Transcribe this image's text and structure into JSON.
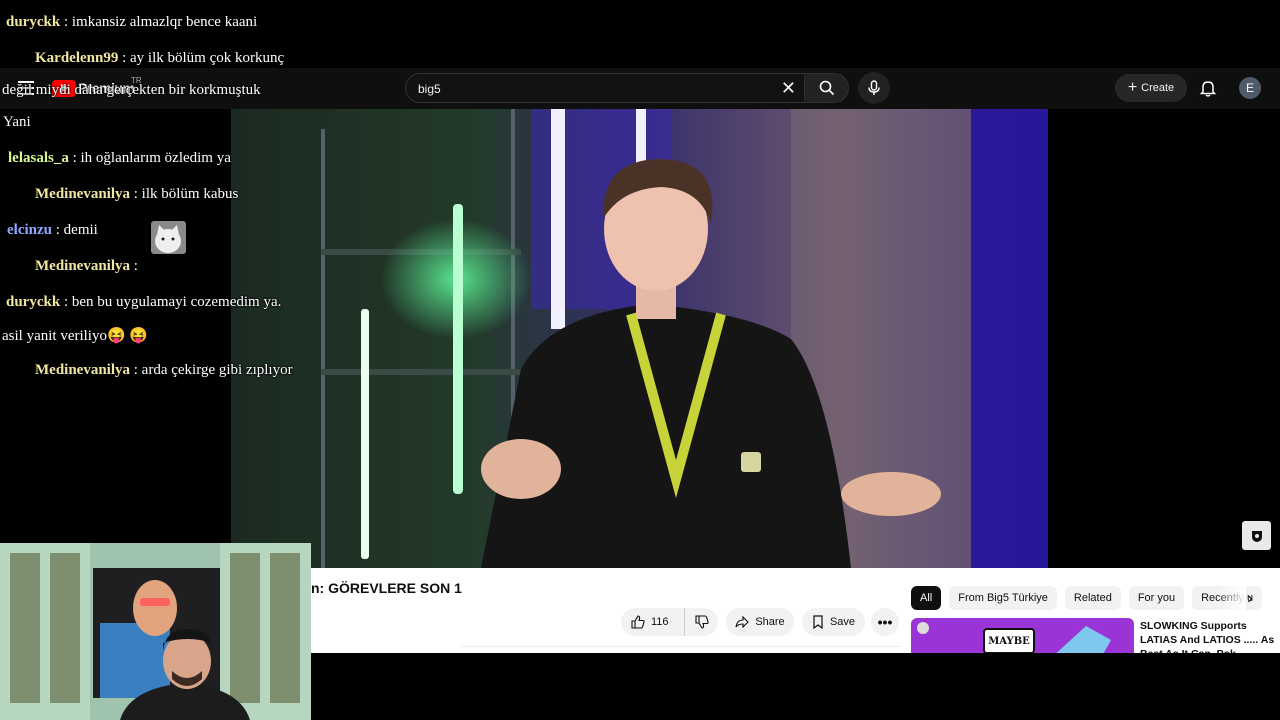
{
  "youtube": {
    "logo_text": "Premium",
    "logo_region": "TR",
    "search": {
      "value": "big5"
    },
    "create_label": "Create",
    "avatar_letter": "E",
    "video_title": "n: GÖREVLERE SON 1",
    "actions": {
      "like_count": "116",
      "share_label": "Share",
      "save_label": "Save"
    },
    "chips": [
      "All",
      "From Big5 Türkiye",
      "Related",
      "For you",
      "Recently u"
    ],
    "recommended": {
      "title": "SLOWKING Supports LATIAS And LATIOS ..... As Best As It Can, Pok…",
      "thumb_text": "MAYBE"
    }
  },
  "chat": [
    {
      "user": "duryckk",
      "text": ": imkansiz almazlqr bence kaani"
    },
    {
      "user": "Kardelenn99",
      "text": ": ay ilk bölüm çok korkunç"
    },
    {
      "user": "",
      "text": "değil miydi daha gerçekten bir korkmuştuk"
    },
    {
      "user": "",
      "text": "Yani"
    },
    {
      "user": "lelasals_a",
      "text": ": ih oğlanlarım özledim ya"
    },
    {
      "user": "Medinevanilya",
      "text": ": ilk bölüm kabus"
    },
    {
      "user": "elcinzu",
      "text": ": demii"
    },
    {
      "user": "Medinevanilya",
      "text": ":"
    },
    {
      "user": "duryckk",
      "text": ": ben bu uygulamayi cozemedim ya."
    },
    {
      "user": "",
      "text": "asil yanit veriliyo😝 😝"
    },
    {
      "user": "Medinevanilya",
      "text": ": arda çekirge gibi zıplıyor"
    }
  ],
  "colors": {
    "chat_username_yellow": "#efe6a2",
    "chat_username_green": "#d7f78e",
    "chat_username_blue": "#8fa7ff",
    "yt_dark": "#0f0f0f",
    "accent_red": "#ff0000"
  },
  "icons": [
    "hamburger-icon",
    "search-icon",
    "close-icon",
    "mic-icon",
    "plus-icon",
    "bell-icon",
    "like-icon",
    "dislike-icon",
    "share-icon",
    "save-icon",
    "more-icon",
    "chevron-right-icon"
  ]
}
